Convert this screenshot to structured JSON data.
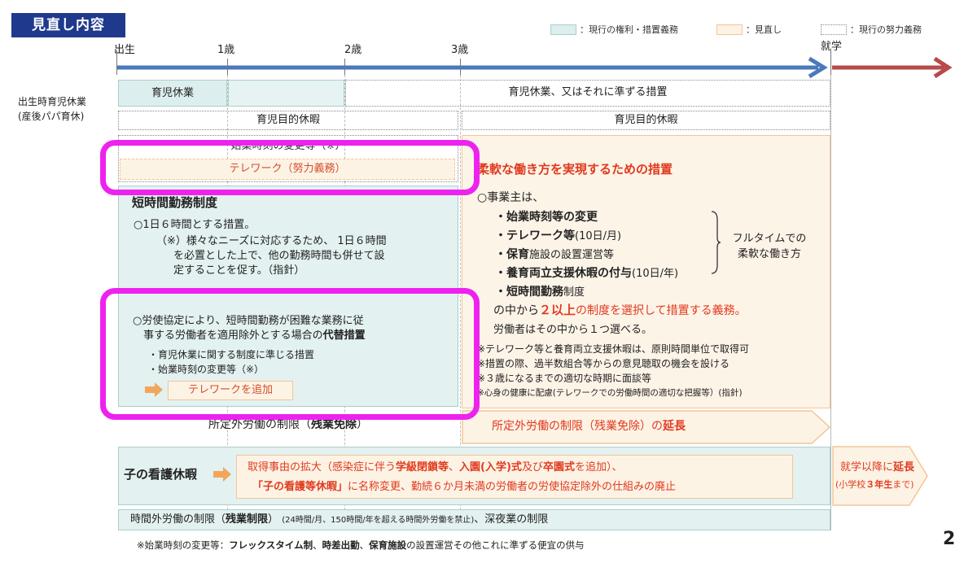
{
  "header": {
    "title": "見直し内容"
  },
  "legend": {
    "current_rights": "：現行の権利・措置義務",
    "revision": "：見直し",
    "current_effort": "：現行の努力義務"
  },
  "timeline": {
    "birth": "出生",
    "age1": "1歳",
    "age2": "2歳",
    "age3": "3歳",
    "school": "就学"
  },
  "left_note": {
    "line1": "出生時育児休業",
    "line2": "(産後パパ育休)"
  },
  "row1": {
    "leave": "育児休業",
    "right": "育児休業、又はそれに準ずる措置"
  },
  "row2": {
    "left": "育児目的休暇",
    "right": "育児目的休暇"
  },
  "left_col": {
    "hidden_text": "始業時刻の変更等（※）",
    "telework_effort": "テレワーク（努力義務）",
    "short_title": "短時間勤務制度",
    "six_hours": "○1日６時間とする措置。",
    "note1": "（※）様々なニーズに対応するため、 1日６時間",
    "note2": "を必置とした上で、他の勤務時間も併せて設",
    "note3": "定することを促す。（指針）",
    "alt1": "○労使協定により、短時間勤務が困難な業務に従",
    "alt2_pre": "事する労働者を適用除外とする場合の",
    "alt2_bold": "代替措置",
    "bullet1": "・育児休業に関する制度に準じる措置",
    "bullet2": "・始業時刻の変更等（※）",
    "add_telework": "テレワークを追加",
    "overtime_pre": "所定外労働の制限（",
    "overtime_bold": "残業免除",
    "overtime_post": "）"
  },
  "right_col": {
    "flex_title": "柔軟な働き方を実現するための措置",
    "employer": "○事業主は、",
    "items": [
      {
        "bold": "・始業時刻等の変更",
        "rest": ""
      },
      {
        "bold": "・テレワーク等",
        "rest": "(10日/月)"
      },
      {
        "bold": "・保育",
        "rest": "施設の設置運営等"
      },
      {
        "bold": "・養育両立支援休暇の付与",
        "rest": "(10日/年)"
      },
      {
        "bold": "・短時間勤務",
        "rest": "制度"
      }
    ],
    "fulltime1": "フルタイムでの",
    "fulltime2": "柔軟な働き方",
    "select_pre": "の中から",
    "select_mid": "２以上",
    "select_post": "の制度を選択して措置する義務。",
    "worker": "労働者はその中から１つ選べる。",
    "notes": [
      "※テレワーク等と養育両立支援休暇は、原則時間単位で取得可",
      "※措置の際、過半数組合等からの意見聴取の機会を設ける",
      "※３歳になるまでの適切な時期に面談等",
      "※心身の健康に配慮(テレワークでの労働時間の適切な把握等）(指針)"
    ],
    "overtime_pre": "所定外労働の制限（残業免除）の",
    "overtime_bold": "延長"
  },
  "sick_leave": {
    "title": "子の看護休暇",
    "l1_a": "取得事由の拡大（感染症に伴う",
    "l1_b": "学級閉鎖等",
    "l1_c": "、",
    "l1_d": "入園(入学)式",
    "l1_e": "及び",
    "l1_f": "卒園式",
    "l1_g": "を追加）、",
    "l2_a": "「子の看護等休暇」",
    "l2_b": "に名称変更、勤続６か月未満の労働者の労使協定除外の仕組みの廃止",
    "ext1_pre": "就学以降に",
    "ext1_bold": "延長",
    "ext2_pre": "(小学校",
    "ext2_bold": "３年生",
    "ext2_post": "まで)"
  },
  "overtime_limit": {
    "pre": "時間外労働の制限（",
    "bold": "残業制限",
    "post": "）",
    "small": "(24時間/月、150時間/年を超える時間外労働を禁止)",
    "tail": "、深夜業の制限"
  },
  "footer": {
    "pre": "※始業時刻の変更等：",
    "b1": "フレックスタイム制",
    "sep1": "、",
    "b2": "時差出勤",
    "sep2": "、",
    "b3": "保育施設",
    "post": "の設置運営その他これに準ずる便宜の供与"
  },
  "page_number": "2"
}
